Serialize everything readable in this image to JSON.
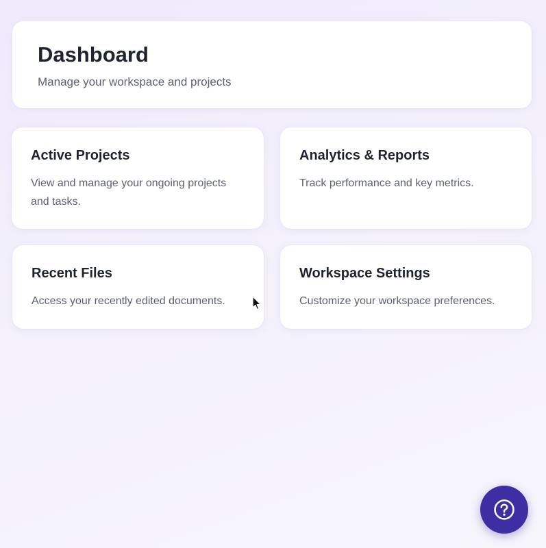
{
  "header": {
    "title": "Dashboard",
    "subtitle": "Manage your workspace and projects"
  },
  "cards": [
    {
      "title": "Active Projects",
      "description": "View and manage your ongoing projects and tasks."
    },
    {
      "title": "Analytics & Reports",
      "description": "Track performance and key metrics."
    },
    {
      "title": "Recent Files",
      "description": "Access your recently edited documents."
    },
    {
      "title": "Workspace Settings",
      "description": "Customize your workspace preferences."
    }
  ],
  "help": {
    "icon": "question-circle-icon"
  },
  "colors": {
    "accent": "#3d2fa3",
    "background": "#f2eefc",
    "card": "#ffffff",
    "title_text": "#1f2230",
    "body_text": "#5d6070"
  }
}
